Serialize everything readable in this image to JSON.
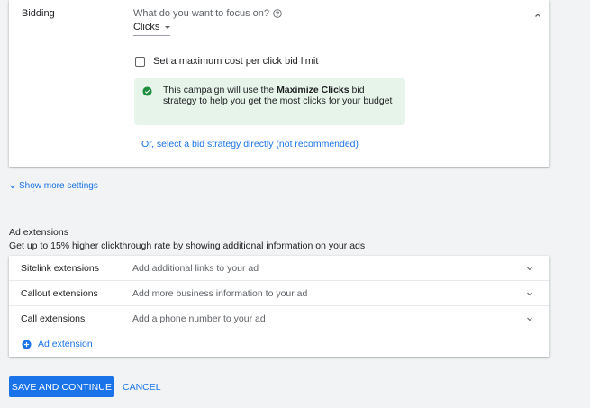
{
  "bidding": {
    "label": "Bidding",
    "focus_question": "What do you want to focus on?",
    "focus_value": "Clicks",
    "max_cpc_label": "Set a maximum cost per click bid limit",
    "max_cpc_checked": false,
    "info_prefix": "This campaign will use the ",
    "info_bold": "Maximize Clicks",
    "info_suffix": " bid strategy to help you get the most clicks for your budget",
    "bid_strategy_link": "Or, select a bid strategy directly (not recommended)"
  },
  "show_more": "Show more settings",
  "extensions": {
    "heading": "Ad extensions",
    "subheading": "Get up to 15% higher clickthrough rate by showing additional information on your ads",
    "rows": [
      {
        "name": "Sitelink extensions",
        "desc": "Add additional links to your ad"
      },
      {
        "name": "Callout extensions",
        "desc": "Add more business information to your ad"
      },
      {
        "name": "Call extensions",
        "desc": "Add a phone number to your ad"
      }
    ],
    "add_label": "Ad extension"
  },
  "actions": {
    "save_label": "SAVE AND CONTINUE",
    "cancel_label": "CANCEL"
  },
  "colors": {
    "accent": "#1a73e8",
    "success_bg": "#e6f4ea",
    "success_icon": "#1e8e3e",
    "page_bg": "#f1f3f4"
  },
  "icons": {
    "help": "help-circle-icon",
    "collapse": "chevron-up-icon",
    "success": "check-circle-icon",
    "expand": "chevron-down-icon",
    "add": "plus-circle-icon"
  }
}
